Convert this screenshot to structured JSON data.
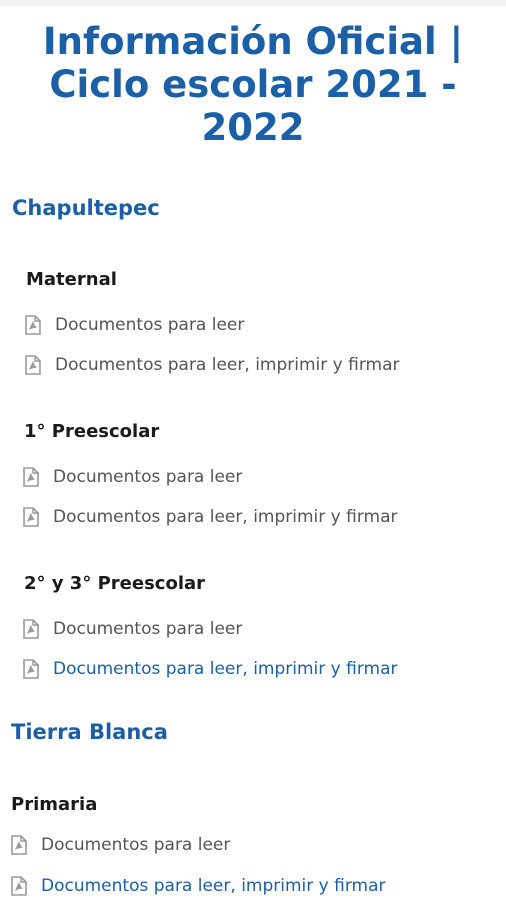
{
  "page": {
    "title": "Información Oficial | Ciclo escolar 2021 - 2022"
  },
  "icons": {
    "document": "pdf-file-icon"
  },
  "colors": {
    "heading_blue": "#1b5fa6",
    "link_gray": "#555555",
    "link_active_blue": "#1b5fa6",
    "level_text": "#1a1a1a"
  },
  "campuses": [
    {
      "name": "Chapultepec",
      "levels": [
        {
          "name": "Maternal",
          "links": [
            {
              "label": "Documentos para leer"
            },
            {
              "label": "Documentos para leer, imprimir y firmar"
            }
          ]
        },
        {
          "name": "1° Preescolar",
          "links": [
            {
              "label": "Documentos para leer"
            },
            {
              "label": "Documentos para leer, imprimir y firmar"
            }
          ]
        },
        {
          "name": "2° y 3° Preescolar",
          "links": [
            {
              "label": "Documentos para leer"
            },
            {
              "label": "Documentos para leer, imprimir y firmar"
            }
          ]
        }
      ]
    },
    {
      "name": "Tierra Blanca",
      "levels": [
        {
          "name": "Primaria",
          "links": [
            {
              "label": "Documentos para leer"
            },
            {
              "label": "Documentos para leer, imprimir y firmar"
            }
          ]
        }
      ]
    }
  ]
}
